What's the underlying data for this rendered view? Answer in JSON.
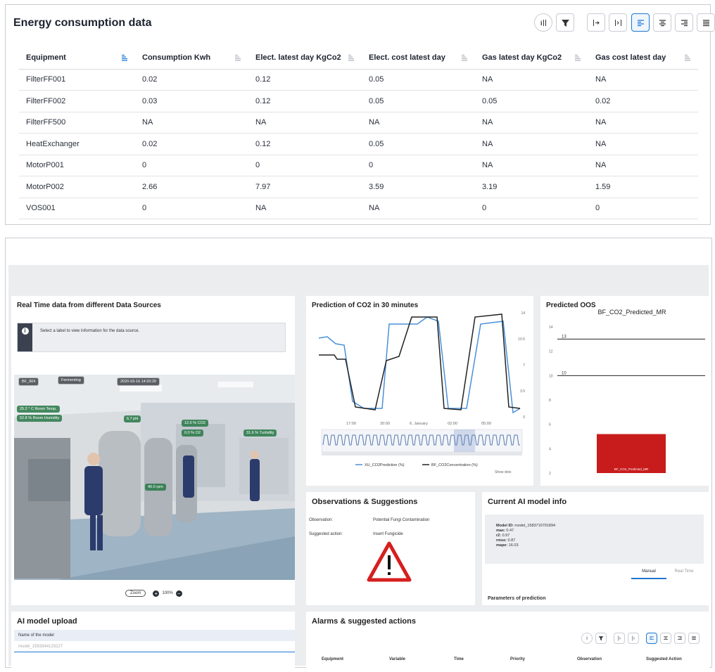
{
  "energy": {
    "title": "Energy consumption data",
    "columns": [
      "Equipment",
      "Consumption Kwh",
      "Elect. latest day KgCo2",
      "Elect. cost latest day",
      "Gas latest day KgCo2",
      "Gas cost latest day"
    ],
    "rows": [
      [
        "FilterFF001",
        "0.02",
        "0.12",
        "0.05",
        "NA",
        "NA"
      ],
      [
        "FilterFF002",
        "0.03",
        "0.12",
        "0.05",
        "0.05",
        "0.02"
      ],
      [
        "FilterFF500",
        "NA",
        "NA",
        "NA",
        "NA",
        "NA"
      ],
      [
        "HeatExchanger",
        "0.02",
        "0.12",
        "0.05",
        "NA",
        "NA"
      ],
      [
        "MotorP001",
        "0",
        "0",
        "0",
        "NA",
        "NA"
      ],
      [
        "MotorP002",
        "2.66",
        "7.97",
        "3.59",
        "3.19",
        "1.59"
      ],
      [
        "VOS001",
        "0",
        "NA",
        "NA",
        "0",
        "0"
      ]
    ],
    "toolbar_icons": [
      "column-info-icon",
      "filter-icon",
      "expand-columns-icon",
      "collapse-columns-icon",
      "align-left-icon",
      "align-center-icon",
      "align-right-icon",
      "align-justify-icon"
    ]
  },
  "realtime": {
    "title": "Real Time data from different Data Sources",
    "info": "Select a label to view information for the data source.",
    "tags": {
      "bf": "BF_904",
      "state": "Fermenting",
      "date": "2020-03-16 14:20:20"
    },
    "readings": {
      "room_temp": "25.2 ° C Room Temp.",
      "humidity": "52.8 % Room Humidity",
      "ph": "6.7 pH",
      "co2": "12.0 % CO2",
      "o2": "0.0 % O2",
      "turbidity": "31.6 % Turbidity",
      "rpm": "40.0 rpm"
    },
    "zoom_label": "Zoom",
    "zoom_level": "100%"
  },
  "co2": {
    "title": "Prediction of CO2 in 30 minutes",
    "legend_pred": "XU_CO2Prediction (%)",
    "legend_conc": "BF_CO2Concentration (%)",
    "show_dots": "Show dots"
  },
  "oos": {
    "title": "Predicted OOS",
    "chart_title": "BF_CO2_Predicted_MR",
    "bar_label": "BF_CO2_Predicted_MR"
  },
  "observations": {
    "title": "Observations & Suggestions",
    "obs_label": "Observation:",
    "obs_value": "Potential Fungi Contamination",
    "action_label": "Suggested action:",
    "action_value": "Insert Fungicide"
  },
  "ai_info": {
    "title": "Current AI model info",
    "model_id_label": "Model ID:",
    "model_id": "model_1583710791894",
    "mae_label": "mae:",
    "mae": "0.47",
    "r2_label": "r2:",
    "r2": "0.97",
    "rmse_label": "rmse:",
    "rmse": "0.87",
    "mape_label": "mape:",
    "mape": "16.03",
    "tab_manual": "Manual",
    "tab_realtime": "Real Time",
    "params_title": "Parameters of prediction"
  },
  "upload": {
    "title": "AI model upload",
    "name_label": "Name of the model",
    "name_value": "model_1583344125227"
  },
  "alarms": {
    "title": "Alarms & suggested actions",
    "columns": [
      "Equipment",
      "Variable",
      "Time",
      "Priority",
      "Observation",
      "Suggested Action"
    ]
  },
  "chart_data": [
    {
      "type": "line",
      "title": "Prediction of CO2 in 30 minutes",
      "x_ticks": [
        "17:00",
        "20:00",
        "6. January",
        "02:00",
        "05:00"
      ],
      "y_ticks": [
        "0",
        "3.5",
        "7",
        "10.5",
        "14"
      ],
      "series": [
        {
          "name": "XU_CO2Prediction (%)",
          "color": "#4a90d9"
        },
        {
          "name": "BF_CO2Concentration (%)",
          "color": "#222222"
        }
      ]
    },
    {
      "type": "line",
      "title": "BF_CO2_Predicted_MR",
      "y_ticks": [
        "2",
        "4",
        "6",
        "8",
        "10",
        "12",
        "14"
      ],
      "reference_lines": [
        13,
        10
      ],
      "bar": {
        "name": "BF_CO2_Predicted_MR",
        "value": 2.6,
        "color": "#c81c1c"
      }
    }
  ]
}
